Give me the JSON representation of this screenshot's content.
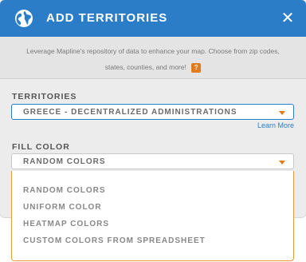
{
  "header": {
    "title": "ADD TERRITORIES",
    "icon": "globe-icon",
    "close_symbol": "✕",
    "color": "#2b7dc8"
  },
  "description": {
    "line1": "Leverage Mapline's repository of data to enhance your map. Choose from zip codes,",
    "line2": "states, counties, and more!",
    "help_symbol": "?"
  },
  "territories": {
    "label": "TERRITORIES",
    "selected": "GREECE - DECENTRALIZED ADMINISTRATIONS",
    "learn_more": "Learn More"
  },
  "fill_color": {
    "label": "FILL COLOR",
    "selected": "RANDOM COLORS",
    "options": [
      "RANDOM COLORS",
      "UNIFORM COLOR",
      "HEATMAP COLORS",
      "CUSTOM COLORS FROM SPREADSHEET"
    ]
  },
  "accent_color": "#e07b1e"
}
